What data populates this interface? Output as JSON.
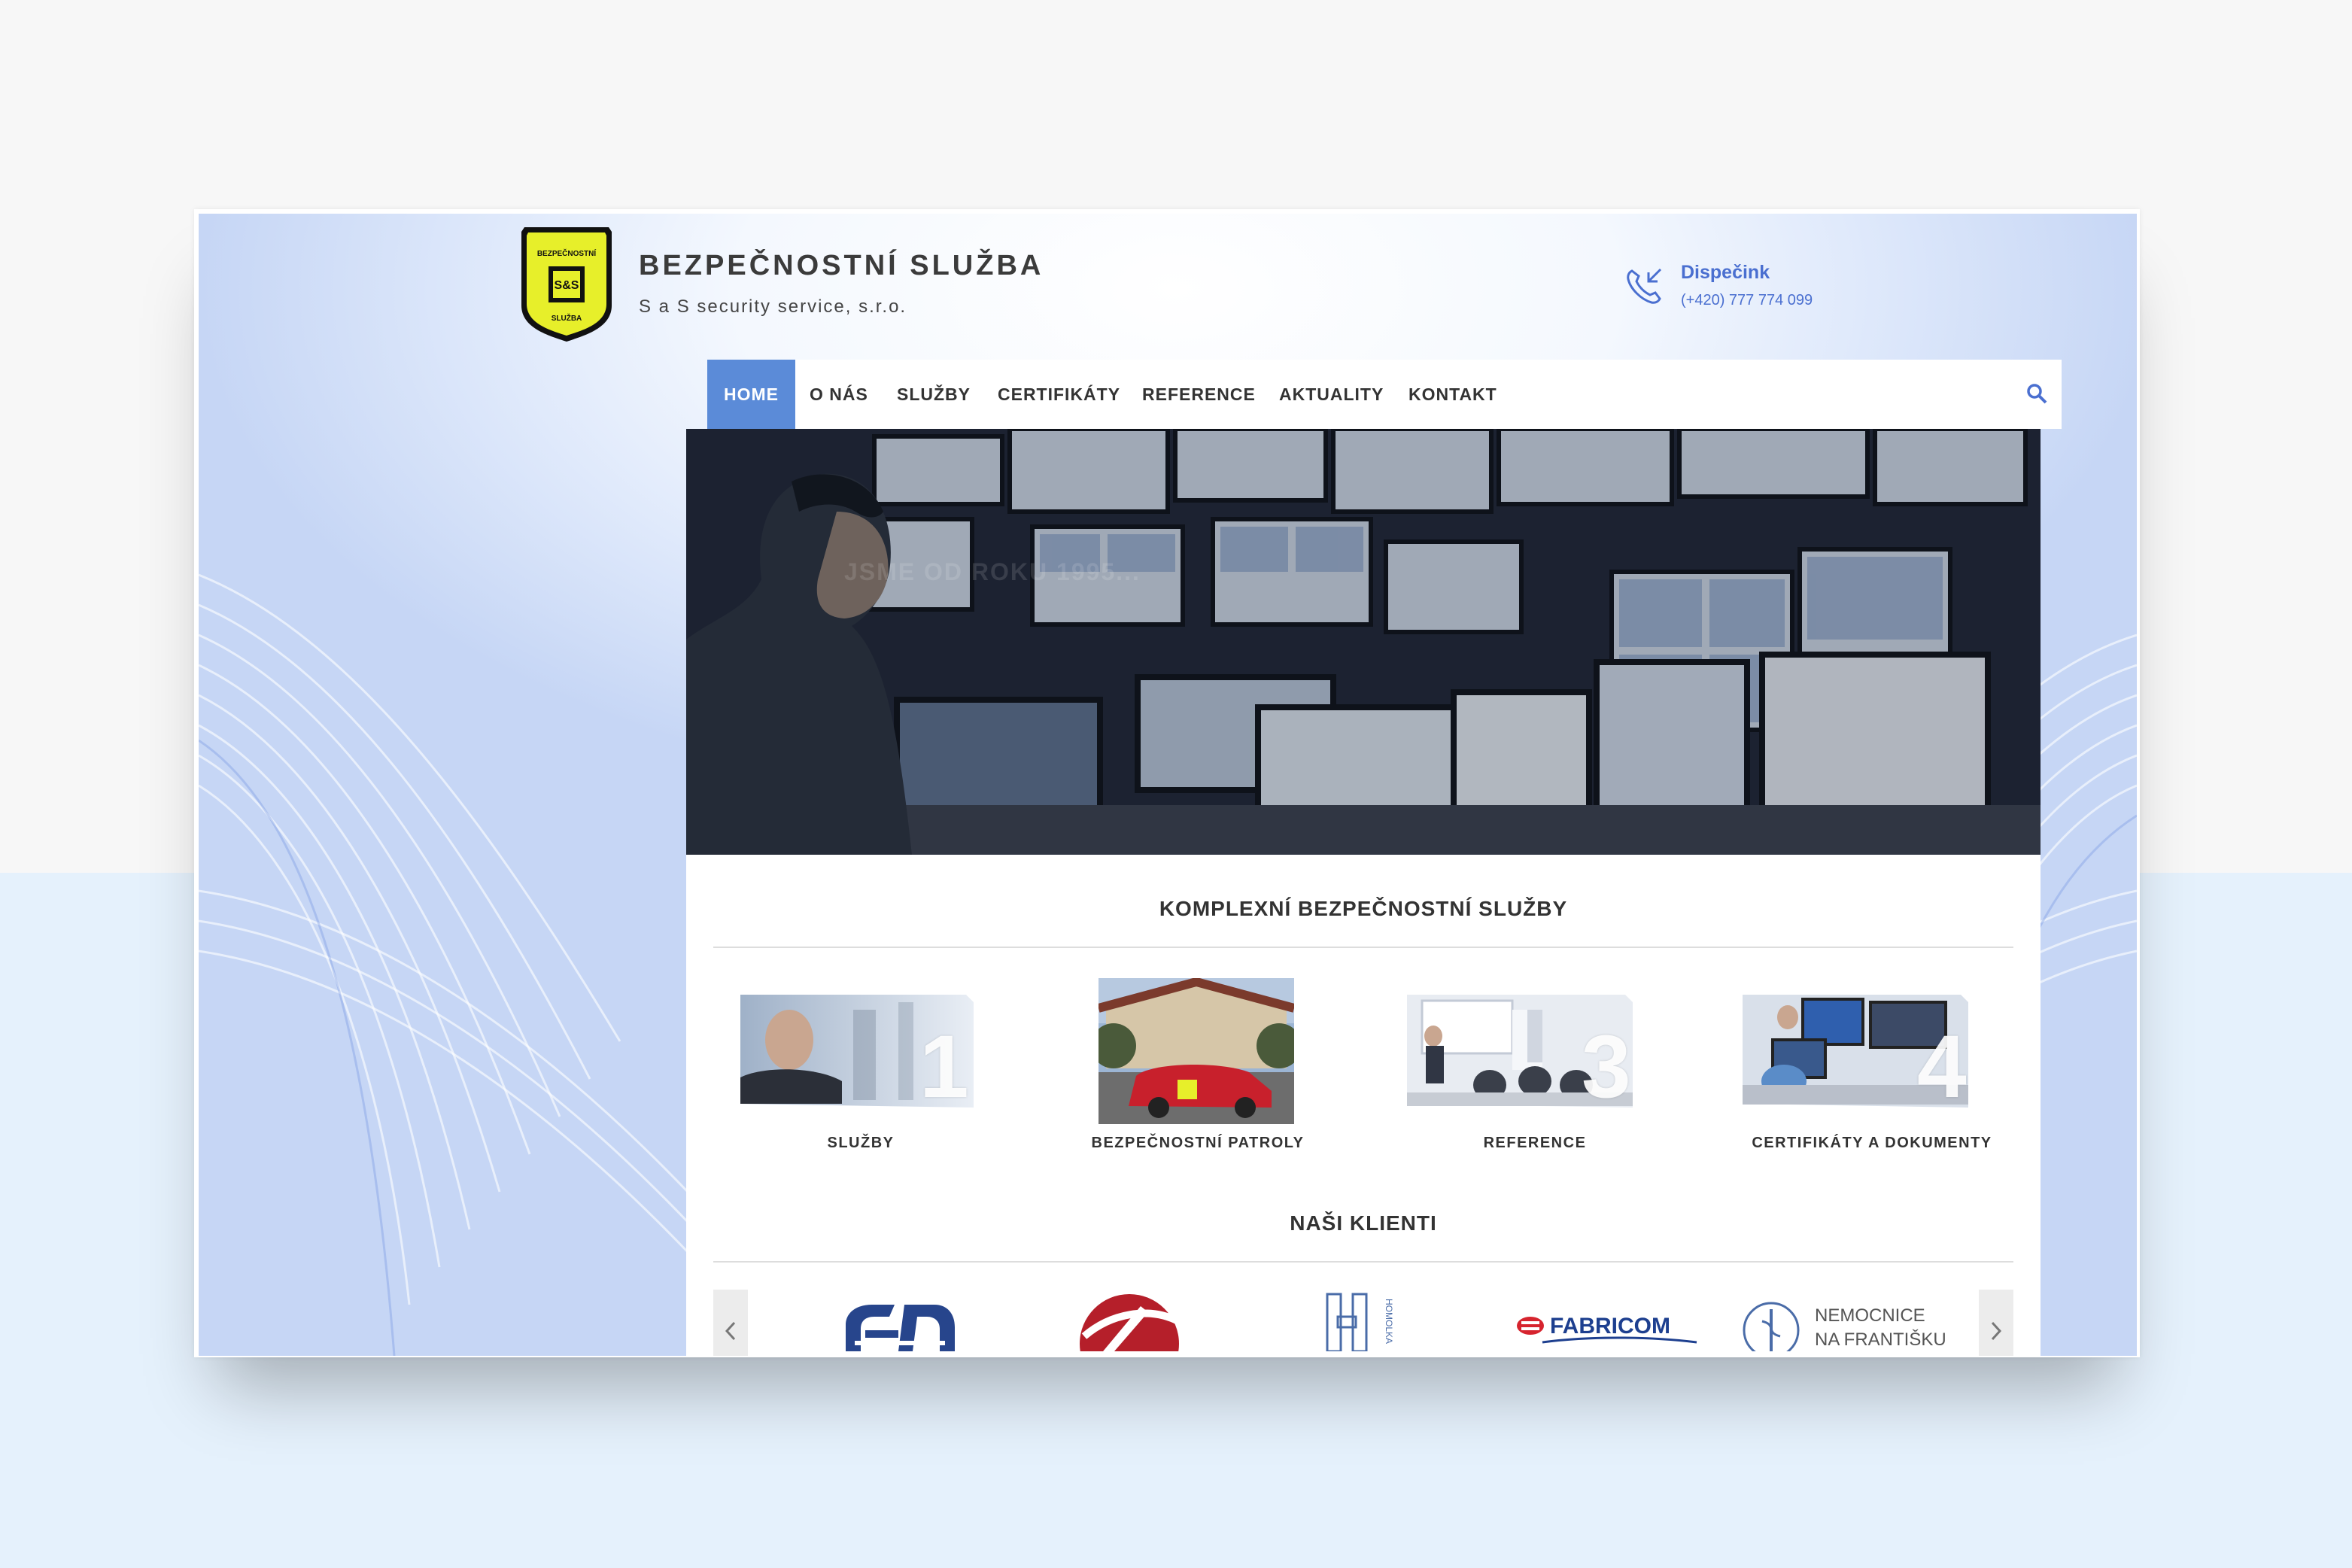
{
  "header": {
    "brand_title": "BEZPEČNOSTNÍ SLUŽBA",
    "brand_subtitle": "S a S security service, s.r.o.",
    "logo_text_top": "BEZPEČNOSTNÍ",
    "logo_text_mid": "S&S",
    "logo_text_bottom": "SLUŽBA",
    "dispatch_label": "Dispečink",
    "dispatch_phone": "(+420) 777 774 099"
  },
  "nav": {
    "items": [
      {
        "label": "HOME",
        "active": true
      },
      {
        "label": "O NÁS"
      },
      {
        "label": "SLUŽBY"
      },
      {
        "label": "CERTIFIKÁTY"
      },
      {
        "label": "REFERENCE"
      },
      {
        "label": "AKTUALITY"
      },
      {
        "label": "KONTAKT"
      }
    ],
    "search_icon": "search-icon"
  },
  "hero": {
    "caption": "JSME OD ROKU 1995..."
  },
  "services": {
    "title": "KOMPLEXNÍ BEZPEČNOSTNÍ SLUŽBY",
    "items": [
      {
        "label": "SLUŽBY",
        "number": "1"
      },
      {
        "label": "BEZPEČNOSTNÍ PATROLY",
        "number": ""
      },
      {
        "label": "REFERENCE",
        "number": "3"
      },
      {
        "label": "CERTIFIKÁTY A DOKUMENTY",
        "number": "4"
      }
    ]
  },
  "clients": {
    "title": "NAŠI KLIENTI",
    "logos": [
      "CD",
      "",
      "HOMOLKA",
      "FABRICOM",
      "NEMOCNICE NA FRANTIŠKU"
    ],
    "prev_icon": "chevron-left-icon",
    "next_icon": "chevron-right-icon"
  },
  "colors": {
    "accent": "#5b8bd8",
    "phone": "#4a6fd0",
    "logo_yellow": "#e7ef2a"
  }
}
